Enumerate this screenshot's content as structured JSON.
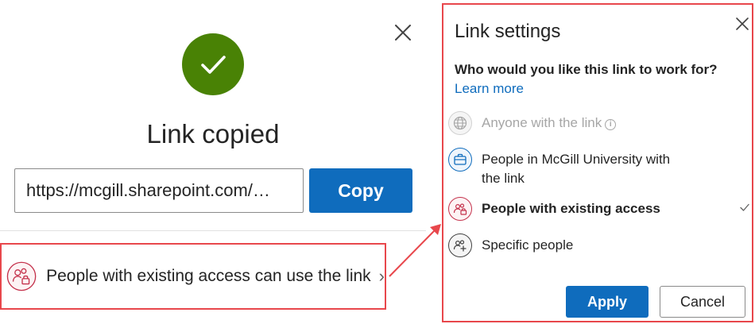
{
  "dialog": {
    "title": "Link copied",
    "link_url": "https://mcgill.sharepoint.com/…",
    "copy_label": "Copy",
    "access_summary": "People with existing access can use the link",
    "access_chevron": "›",
    "success_icon": "checkmark-icon",
    "success_color": "#498205"
  },
  "settings": {
    "title": "Link settings",
    "question": "Who would you like this link to work for?",
    "learn_more": "Learn more",
    "options": [
      {
        "label": "Anyone with the link",
        "icon": "globe-icon",
        "disabled": true,
        "selected": false
      },
      {
        "label_line1": "People in McGill University with",
        "label_line2": "the link",
        "icon": "briefcase-icon",
        "disabled": false,
        "selected": false
      },
      {
        "label": "People with existing access",
        "icon": "people-lock-icon",
        "disabled": false,
        "selected": true
      },
      {
        "label": "Specific people",
        "icon": "people-add-icon",
        "disabled": false,
        "selected": false
      }
    ],
    "apply_label": "Apply",
    "cancel_label": "Cancel"
  },
  "colors": {
    "accent": "#0f6cbd",
    "highlight_border": "#e8474c",
    "success": "#498205"
  }
}
